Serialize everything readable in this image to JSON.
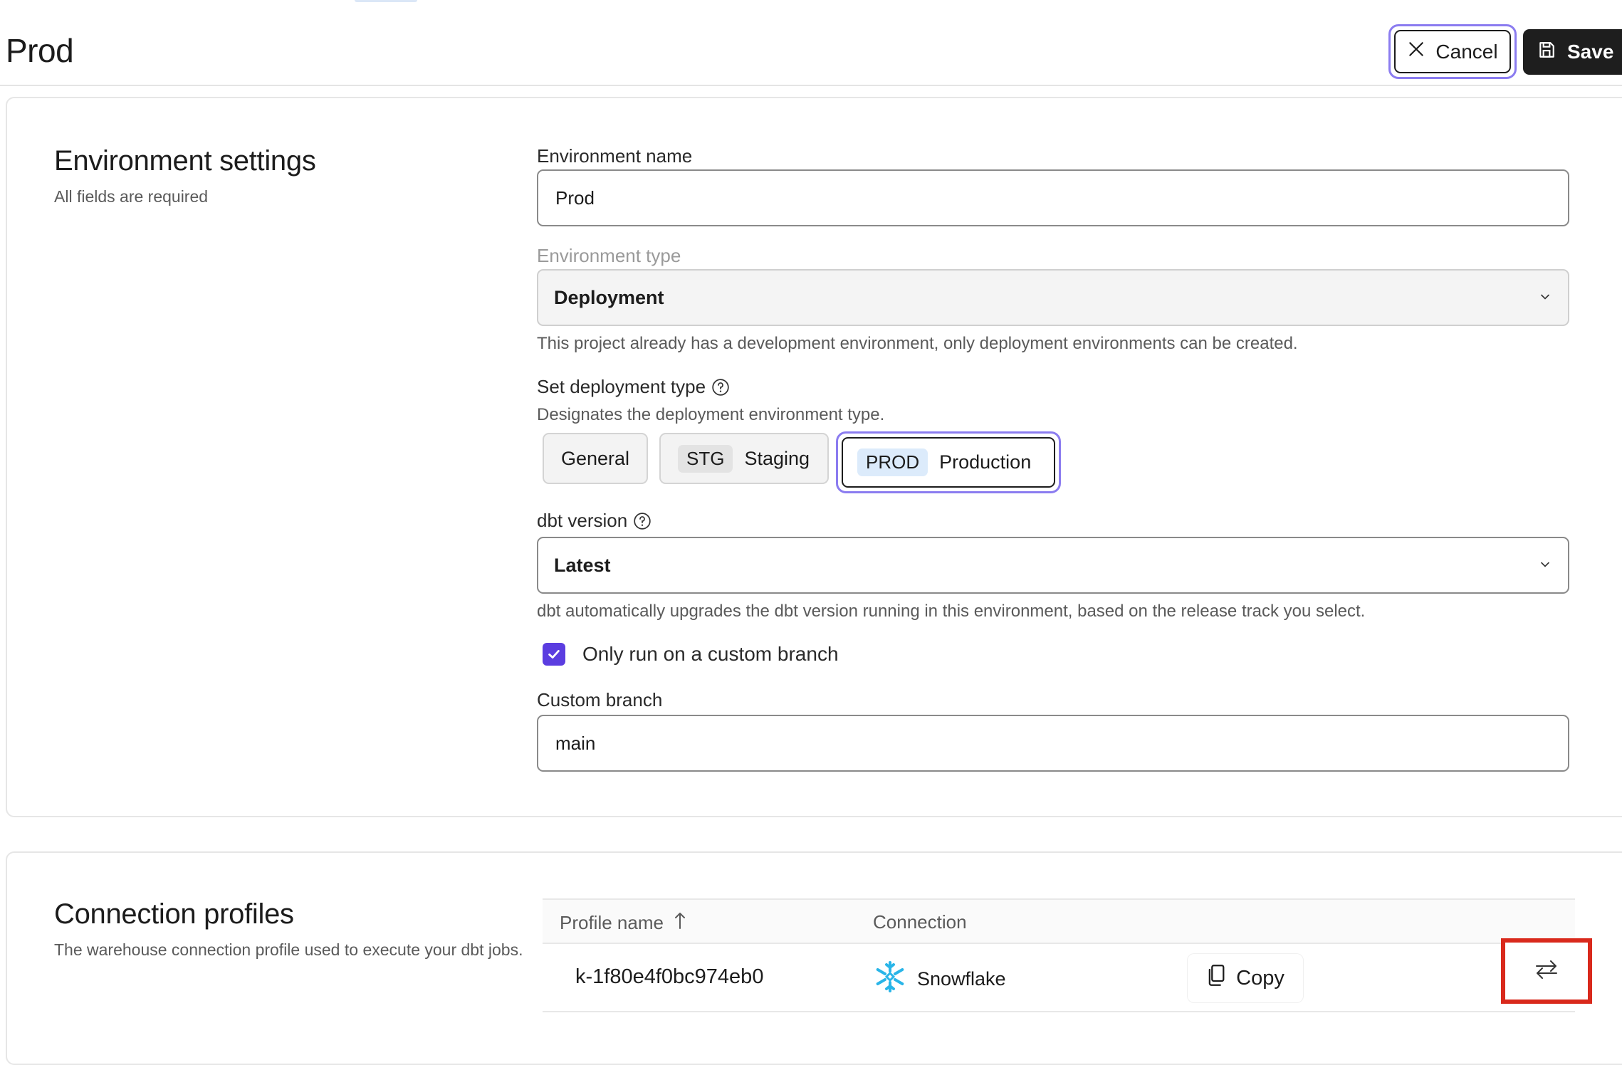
{
  "header": {
    "title": "Prod",
    "cancel_label": "Cancel",
    "save_label": "Save"
  },
  "environment_settings": {
    "title": "Environment settings",
    "subtitle": "All fields are required",
    "env_name": {
      "label": "Environment name",
      "value": "Prod"
    },
    "env_type": {
      "label": "Environment type",
      "value": "Deployment",
      "help": "This project already has a development environment, only deployment environments can be created."
    },
    "deployment_type": {
      "label": "Set deployment type",
      "help": "Designates the deployment environment type.",
      "options": [
        {
          "label": "General",
          "tag": ""
        },
        {
          "label": "Staging",
          "tag": "STG"
        },
        {
          "label": "Production",
          "tag": "PROD",
          "selected": true
        }
      ]
    },
    "dbt_version": {
      "label": "dbt version",
      "value": "Latest",
      "help": "dbt automatically upgrades the dbt version running in this environment, based on the release track you select."
    },
    "custom_branch_checkbox": {
      "label": "Only run on a custom branch",
      "checked": true
    },
    "custom_branch": {
      "label": "Custom branch",
      "value": "main"
    }
  },
  "connection_profiles": {
    "title": "Connection profiles",
    "subtitle": "The warehouse connection profile used to execute your dbt jobs.",
    "columns": [
      "Profile name",
      "Connection"
    ],
    "rows": [
      {
        "profile_name": "k-1f80e4f0bc974eb0",
        "connection": "Snowflake",
        "copy_label": "Copy"
      }
    ]
  },
  "colors": {
    "accent_focus": "#8b7cf0",
    "checkbox": "#5b3de0",
    "highlight_box": "#d9291c",
    "snowflake": "#29b5e8"
  }
}
